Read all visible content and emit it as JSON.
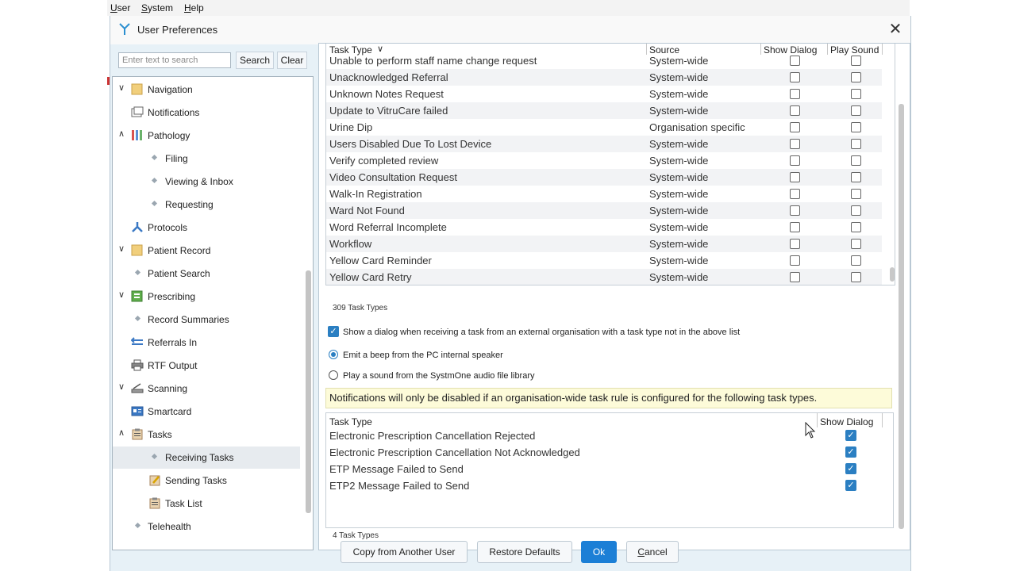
{
  "menubar": {
    "items": [
      "User",
      "System",
      "Help"
    ]
  },
  "dialog": {
    "title": "User Preferences",
    "close_glyph": "✕"
  },
  "search": {
    "placeholder": "Enter text to search",
    "value": "",
    "search_label": "Search",
    "clear_label": "Clear"
  },
  "tree": {
    "items": [
      {
        "label": "Navigation",
        "icon": "folder-icon",
        "expanded": true
      },
      {
        "label": "Notifications",
        "icon": "notifications-icon"
      },
      {
        "label": "Pathology",
        "icon": "test-tubes-icon",
        "expanded": true
      },
      {
        "label": "Filing"
      },
      {
        "label": "Viewing & Inbox"
      },
      {
        "label": "Requesting"
      },
      {
        "label": "Protocols",
        "icon": "protocols-icon"
      },
      {
        "label": "Patient Record",
        "icon": "folder-icon",
        "expanded": true
      },
      {
        "label": "Patient Search"
      },
      {
        "label": "Prescribing",
        "icon": "prescribing-icon",
        "expanded": true
      },
      {
        "label": "Record Summaries"
      },
      {
        "label": "Referrals In",
        "icon": "referrals-icon"
      },
      {
        "label": "RTF Output",
        "icon": "printer-icon"
      },
      {
        "label": "Scanning",
        "icon": "scanner-icon",
        "expanded": true
      },
      {
        "label": "Smartcard",
        "icon": "smartcard-icon"
      },
      {
        "label": "Tasks",
        "icon": "clipboard-icon",
        "expanded": true
      },
      {
        "label": "Receiving Tasks",
        "selected": true
      },
      {
        "label": "Sending Tasks",
        "icon": "clipboard-pen-icon"
      },
      {
        "label": "Task List",
        "icon": "clipboard-icon"
      },
      {
        "label": "Telehealth"
      }
    ]
  },
  "task_grid": {
    "headers": {
      "task_type": "Task Type",
      "source": "Source",
      "show_dialog": "Show Dialog",
      "play_sound": "Play Sound"
    },
    "rows": [
      {
        "task_type": "Unable to perform staff name change request",
        "source": "System-wide"
      },
      {
        "task_type": "Unacknowledged Referral",
        "source": "System-wide"
      },
      {
        "task_type": "Unknown Notes Request",
        "source": "System-wide"
      },
      {
        "task_type": "Update to VitruCare failed",
        "source": "System-wide"
      },
      {
        "task_type": "Urine Dip",
        "source": "Organisation specific"
      },
      {
        "task_type": "Users Disabled Due To Lost Device",
        "source": "System-wide"
      },
      {
        "task_type": "Verify completed review",
        "source": "System-wide"
      },
      {
        "task_type": "Video Consultation Request",
        "source": "System-wide"
      },
      {
        "task_type": "Walk-In Registration",
        "source": "System-wide"
      },
      {
        "task_type": "Ward Not Found",
        "source": "System-wide"
      },
      {
        "task_type": "Word Referral Incomplete",
        "source": "System-wide"
      },
      {
        "task_type": "Workflow",
        "source": "System-wide"
      },
      {
        "task_type": "Yellow Card Reminder",
        "source": "System-wide"
      },
      {
        "task_type": "Yellow Card Retry",
        "source": "System-wide"
      }
    ],
    "count_label": "309 Task Types"
  },
  "options": {
    "show_dialog_external": "Show a dialog when receiving a task from an external organisation with a task type not in the above list",
    "beep": "Emit a beep from the PC internal speaker",
    "play_sound": "Play a sound from the SystmOne audio file library"
  },
  "notice": "Notifications will only be disabled if an organisation-wide task rule is configured for the following task types.",
  "disabled_grid": {
    "headers": {
      "task_type": "Task Type",
      "show_dialog": "Show Dialog"
    },
    "rows": [
      {
        "task_type": "Electronic Prescription Cancellation Rejected"
      },
      {
        "task_type": "Electronic Prescription Cancellation Not Acknowledged"
      },
      {
        "task_type": "ETP Message Failed to Send"
      },
      {
        "task_type": "ETP2 Message Failed to Send"
      }
    ],
    "count_label": "4 Task Types"
  },
  "footer": {
    "copy_label": "Copy from Another User",
    "restore_label": "Restore Defaults",
    "ok_label": "Ok",
    "cancel_label": "Cancel"
  },
  "colors": {
    "accent": "#1c7fd6",
    "selected_row": "#e7ebef",
    "notice_bg": "#fdfbd9",
    "dialog_bg": "#e7f1f7"
  }
}
